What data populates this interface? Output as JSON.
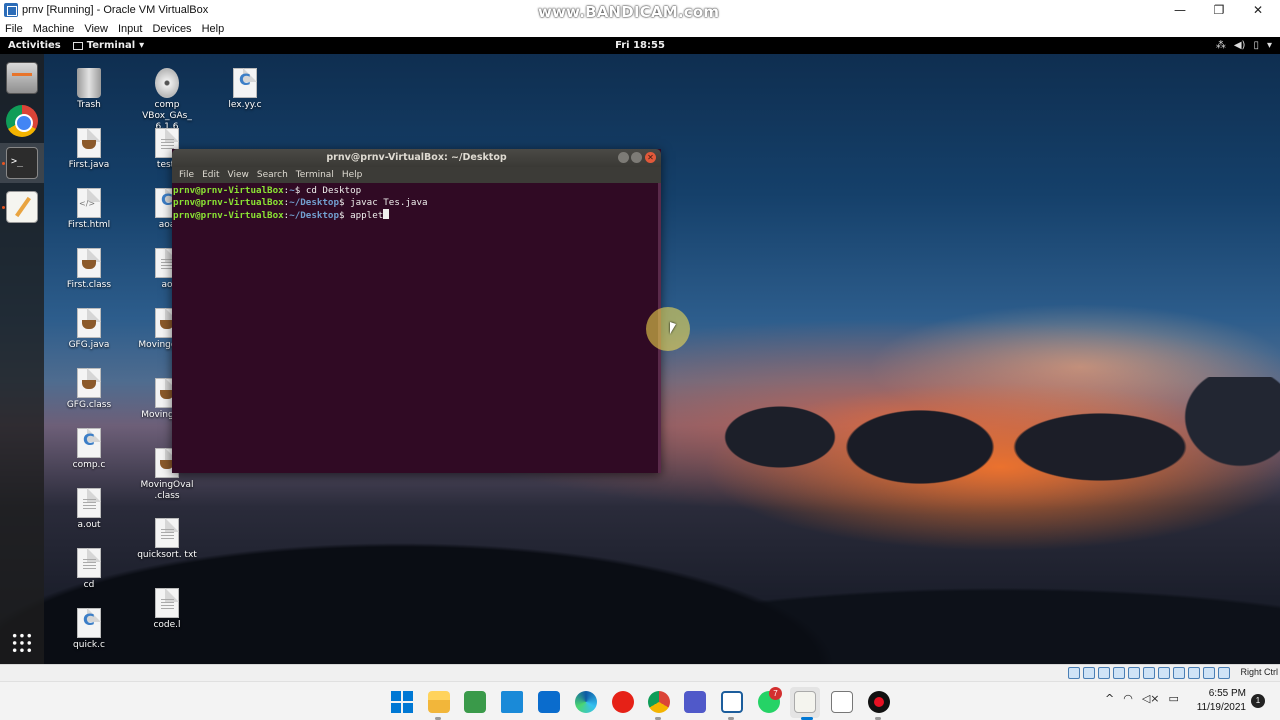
{
  "host_window": {
    "title": "prnv [Running] - Oracle VM VirtualBox",
    "watermark": "www.BANDICAM.com",
    "menu": [
      "File",
      "Machine",
      "View",
      "Input",
      "Devices",
      "Help"
    ],
    "controls": {
      "minimize": "—",
      "restore": "❐",
      "close": "✕"
    },
    "host_key_label": "Right Ctrl"
  },
  "gnome_topbar": {
    "activities": "Activities",
    "app_menu": "Terminal",
    "clock": "Fri 18:55",
    "tray_icons": [
      "network-icon",
      "volume-icon",
      "battery-icon",
      "power-menu-icon"
    ]
  },
  "dock": {
    "items": [
      "files-icon",
      "chrome-icon",
      "terminal-icon",
      "text-editor-icon"
    ],
    "show_apps_icon": "app-grid-icon"
  },
  "desktop_icons": [
    {
      "label": "Trash",
      "type": "trash"
    },
    {
      "label": "First.java",
      "type": "java"
    },
    {
      "label": "First.html",
      "type": "html"
    },
    {
      "label": "First.class",
      "type": "java"
    },
    {
      "label": "GFG.java",
      "type": "java"
    },
    {
      "label": "GFG.class",
      "type": "java"
    },
    {
      "label": "comp.c",
      "type": "c"
    },
    {
      "label": "a.out",
      "type": "txt"
    },
    {
      "label": "cd",
      "type": "txt"
    },
    {
      "label": "quick.c",
      "type": "c"
    },
    {
      "label": "comp VBox_GAs_ 6.1.6",
      "type": "disc"
    },
    {
      "label": "test.",
      "type": "txt"
    },
    {
      "label": "aoa",
      "type": "c"
    },
    {
      "label": "ao",
      "type": "txt"
    },
    {
      "label": "Movingg .jav",
      "type": "java"
    },
    {
      "label": "Moving .jav",
      "type": "java"
    },
    {
      "label": "MovingOval .class",
      "type": "java"
    },
    {
      "label": "quicksort. txt",
      "type": "txt"
    },
    {
      "label": "code.l",
      "type": "txt"
    },
    {
      "label": "lex.yy.c",
      "type": "c"
    }
  ],
  "terminal": {
    "title": "prnv@prnv-VirtualBox: ~/Desktop",
    "menu": [
      "File",
      "Edit",
      "View",
      "Search",
      "Terminal",
      "Help"
    ],
    "lines": [
      {
        "user": "prnv@prnv-VirtualBox",
        "sep": ":",
        "path": "~",
        "prompt": "$ ",
        "cmd": "cd Desktop"
      },
      {
        "user": "prnv@prnv-VirtualBox",
        "sep": ":",
        "path": "~/Desktop",
        "prompt": "$ ",
        "cmd": "javac Tes.java"
      },
      {
        "user": "prnv@prnv-VirtualBox",
        "sep": ":",
        "path": "~/Desktop",
        "prompt": "$ ",
        "cmd": "applet"
      }
    ]
  },
  "taskbar": {
    "apps": [
      "windows-start-icon",
      "file-explorer-icon",
      "notepad-icon",
      "remote-desktop-icon",
      "mail-icon",
      "edge-icon",
      "youtube-icon",
      "chrome-icon",
      "teams-icon",
      "virtualbox-icon",
      "whatsapp-icon",
      "text-editor-icon",
      "snipping-icon",
      "bandicam-record-icon"
    ],
    "whatsapp_badge": "7",
    "time": "6:55 PM",
    "date": "11/19/2021",
    "notification_count": "1",
    "tray": [
      "chevron-up-icon",
      "wifi-icon",
      "volume-muted-icon",
      "battery-icon"
    ]
  },
  "colors": {
    "terminal_bg": "#300a24",
    "prompt_user": "#8ae234",
    "prompt_path": "#729fcf",
    "gnome_bar": "#000000",
    "taskbar": "#f3f3f3"
  }
}
